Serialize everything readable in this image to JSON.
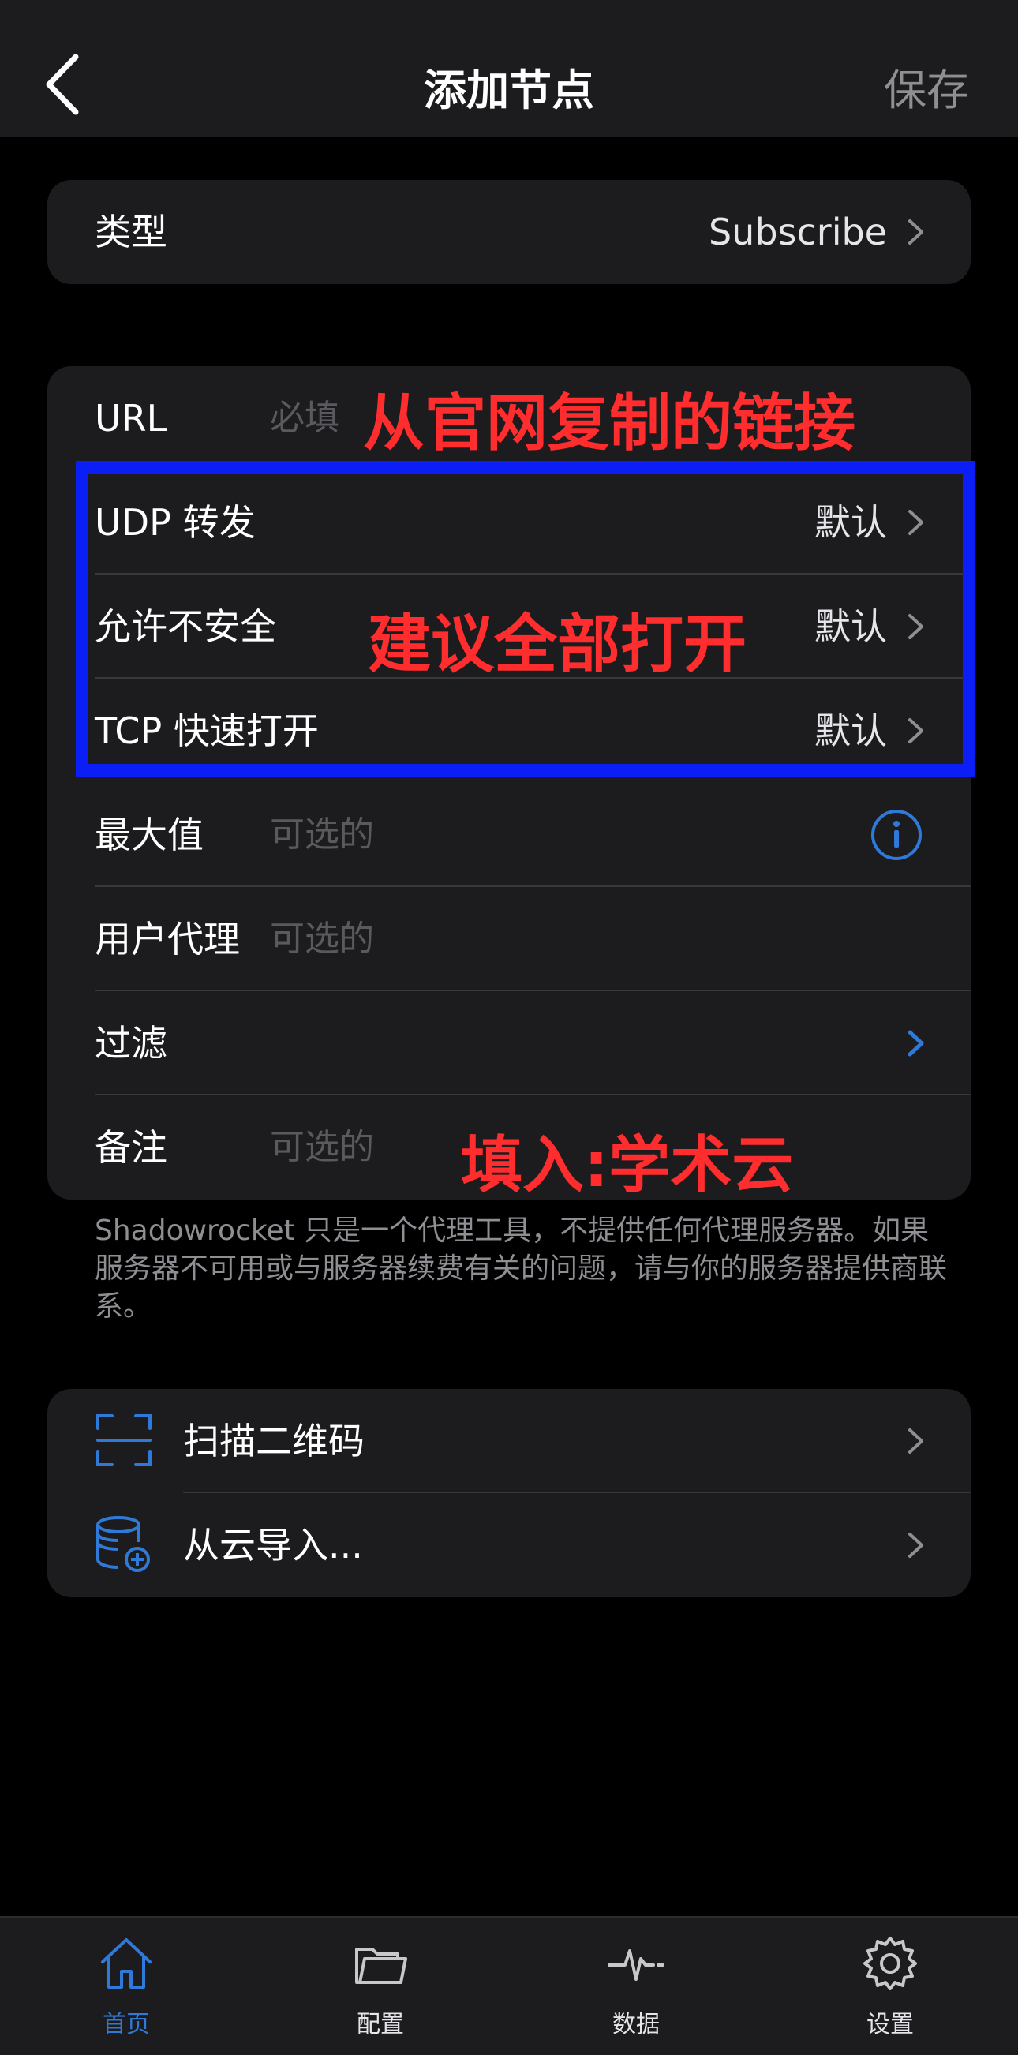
{
  "nav": {
    "title": "添加节点",
    "save_label": "保存"
  },
  "type_row": {
    "label": "类型",
    "value": "Subscribe"
  },
  "form": {
    "url": {
      "label": "URL",
      "placeholder": "必填"
    },
    "udp": {
      "label": "UDP 转发",
      "value": "默认"
    },
    "insecure": {
      "label": "允许不安全",
      "value": "默认"
    },
    "tfo": {
      "label": "TCP 快速打开",
      "value": "默认"
    },
    "max": {
      "label": "最大值",
      "placeholder": "可选的"
    },
    "ua": {
      "label": "用户代理",
      "placeholder": "可选的"
    },
    "filter": {
      "label": "过滤"
    },
    "remark": {
      "label": "备注",
      "placeholder": "可选的"
    }
  },
  "annotations": {
    "url_hint": "从官网复制的链接",
    "toggle_hint": "建议全部打开",
    "remark_hint": "填入:学术云"
  },
  "footnote": "Shadowrocket 只是一个代理工具，不提供任何代理服务器。如果服务器不可用或与服务器续费有关的问题，请与你的服务器提供商联系。",
  "import": {
    "scan": "扫描二维码",
    "cloud": "从云导入..."
  },
  "tabs": [
    {
      "label": "首页",
      "icon": "home-icon"
    },
    {
      "label": "配置",
      "icon": "folder-icon"
    },
    {
      "label": "数据",
      "icon": "pulse-icon"
    },
    {
      "label": "设置",
      "icon": "gear-icon"
    }
  ],
  "colors": {
    "accent": "#2f7ad9",
    "annotation": "#ff2d2d",
    "highlight": "#0a1ef5"
  }
}
